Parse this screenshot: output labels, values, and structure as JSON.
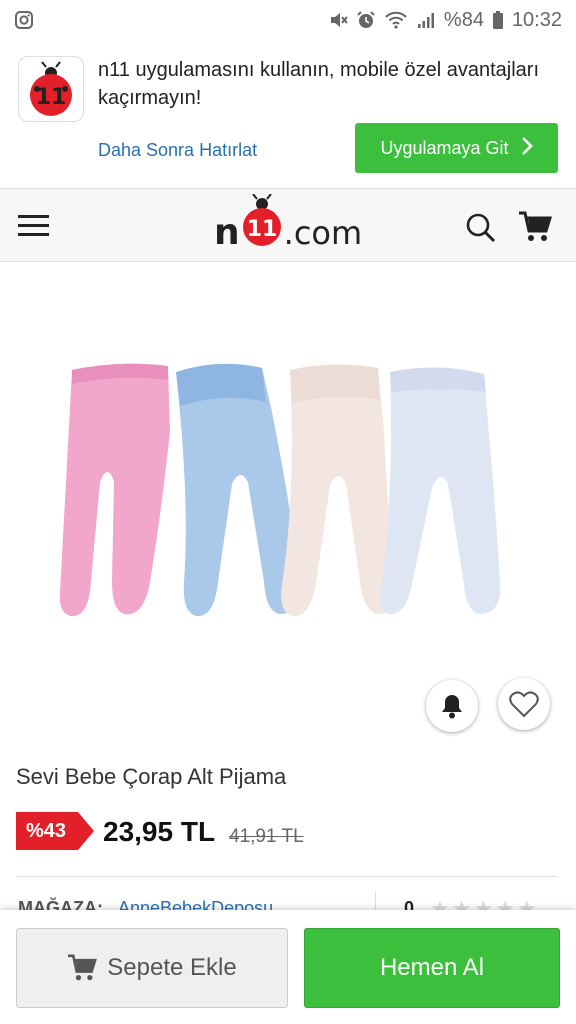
{
  "status_bar": {
    "left_icon": "instagram-icon",
    "battery_percent": "%84",
    "time": "10:32"
  },
  "app_banner": {
    "message": "n11 uygulamasını kullanın, mobile özel avantajları kaçırmayın!",
    "remind_label": "Daha Sonra Hatırlat",
    "open_app_label": "Uygulamaya Git",
    "logo_text": "11"
  },
  "header": {
    "logo_n": "n",
    "logo_11": "11",
    "logo_domain": ".com"
  },
  "product": {
    "title": "Sevi Bebe Çorap Alt Pijama",
    "discount": "%43",
    "price": "23,95 TL",
    "old_price": "41,91 TL",
    "store_label": "MAĞAZA:",
    "store_name": "AnneBebekDeposu",
    "rating_count": "0"
  },
  "bottom_bar": {
    "add_to_cart_label": "Sepete Ekle",
    "buy_now_label": "Hemen Al"
  },
  "colors": {
    "brand_red": "#e3202a",
    "accent_green": "#3cbf3c",
    "link_blue": "#2a6fb4"
  }
}
